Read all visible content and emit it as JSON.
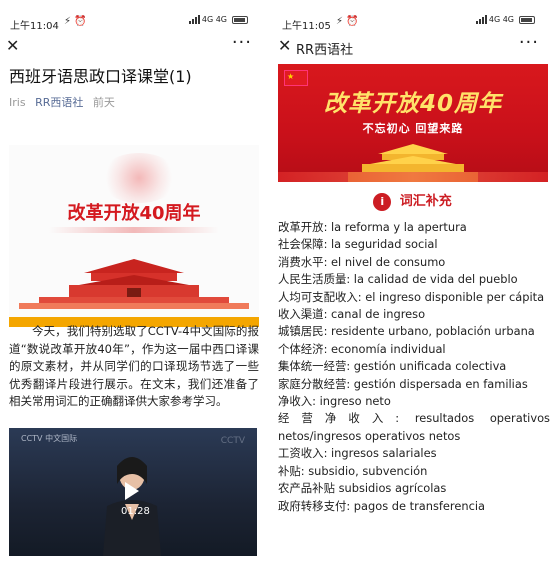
{
  "left": {
    "status": {
      "time": "上午11:04",
      "icons": "⚡ ⏰",
      "network": "4G 4G"
    },
    "nav": {
      "close": "✕",
      "more": "···"
    },
    "article": {
      "title": "西班牙语思政口译课堂(1)",
      "author": "Iris",
      "account": "RR西语社",
      "date": "前天"
    },
    "banner": {
      "title": "改革开放40周年"
    },
    "paragraph": "今天，我们特别选取了CCTV-4中文国际的报道“数说改革开放40年”，作为这一届中西口译课的原文素材，并从同学们的口译现场节选了一些优秀翻译片段进行展示。在文末，我们还准备了相关常用词汇的正确翻译供大家参考学习。",
    "video": {
      "duration": "01:28",
      "logo": "CCTV 中文国际",
      "logo2": "CCTV"
    }
  },
  "right": {
    "status": {
      "time": "上午11:05",
      "icons": "⚡ ⏰",
      "network": "4G 4G"
    },
    "nav": {
      "close": "✕",
      "title": "RR西语社",
      "more": "···"
    },
    "banner": {
      "title": "改革开放40周年",
      "subtitle": "不忘初心 回望来路"
    },
    "section": {
      "title": "词汇补充",
      "badge": "i"
    },
    "vocab": [
      "改革开放: la reforma y la apertura",
      "社会保障: la seguridad social",
      "消费水平: el nivel de consumo",
      "人民生活质量: la calidad de vida del pueblo",
      "人均可支配收入: el ingreso disponible per cápita",
      "收入渠道: canal de ingreso",
      "城镇居民: residente urbano, población urbana",
      "个体经济: economía individual",
      "集体统一经营: gestión unificada colectiva",
      "家庭分散经营: gestión dispersada en familias",
      "净收入: ingreso neto",
      "经营净收入: resultados operativos netos/ingresos operativos netos",
      "工资收入: ingresos salariales",
      "补贴: subsidio, subvención",
      "农产品补贴 subsidios agrícolas",
      "政府转移支付: pagos de transferencia"
    ]
  }
}
